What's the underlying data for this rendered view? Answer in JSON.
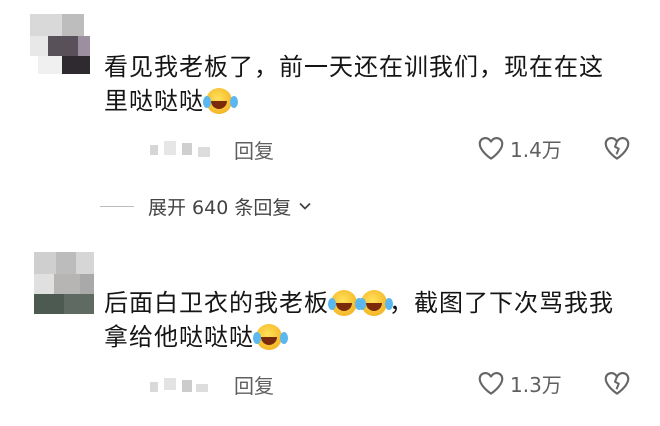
{
  "comments": [
    {
      "text_parts": [
        "看见我老板了，前一天还在训我们，现在在这里哒哒哒"
      ],
      "emojis": [
        "laughing-crying-emoji"
      ],
      "reply_label": "回复",
      "like_count": "1.4万"
    },
    {
      "text_parts": [
        "后面白卫衣的我老板",
        "，截图了下次骂我我拿给他哒哒哒"
      ],
      "emojis": [
        "laughing-crying-emoji",
        "laughing-crying-emoji",
        "laughing-crying-emoji"
      ],
      "reply_label": "回复",
      "like_count": "1.3万"
    }
  ],
  "expand_replies": {
    "label": "展开 640 条回复"
  },
  "colors": {
    "text": "#151515",
    "meta": "#5f5f5f",
    "emoji": "#f5b82a"
  },
  "icons": [
    "heart-icon",
    "broken-heart-icon",
    "chevron-down-icon"
  ]
}
